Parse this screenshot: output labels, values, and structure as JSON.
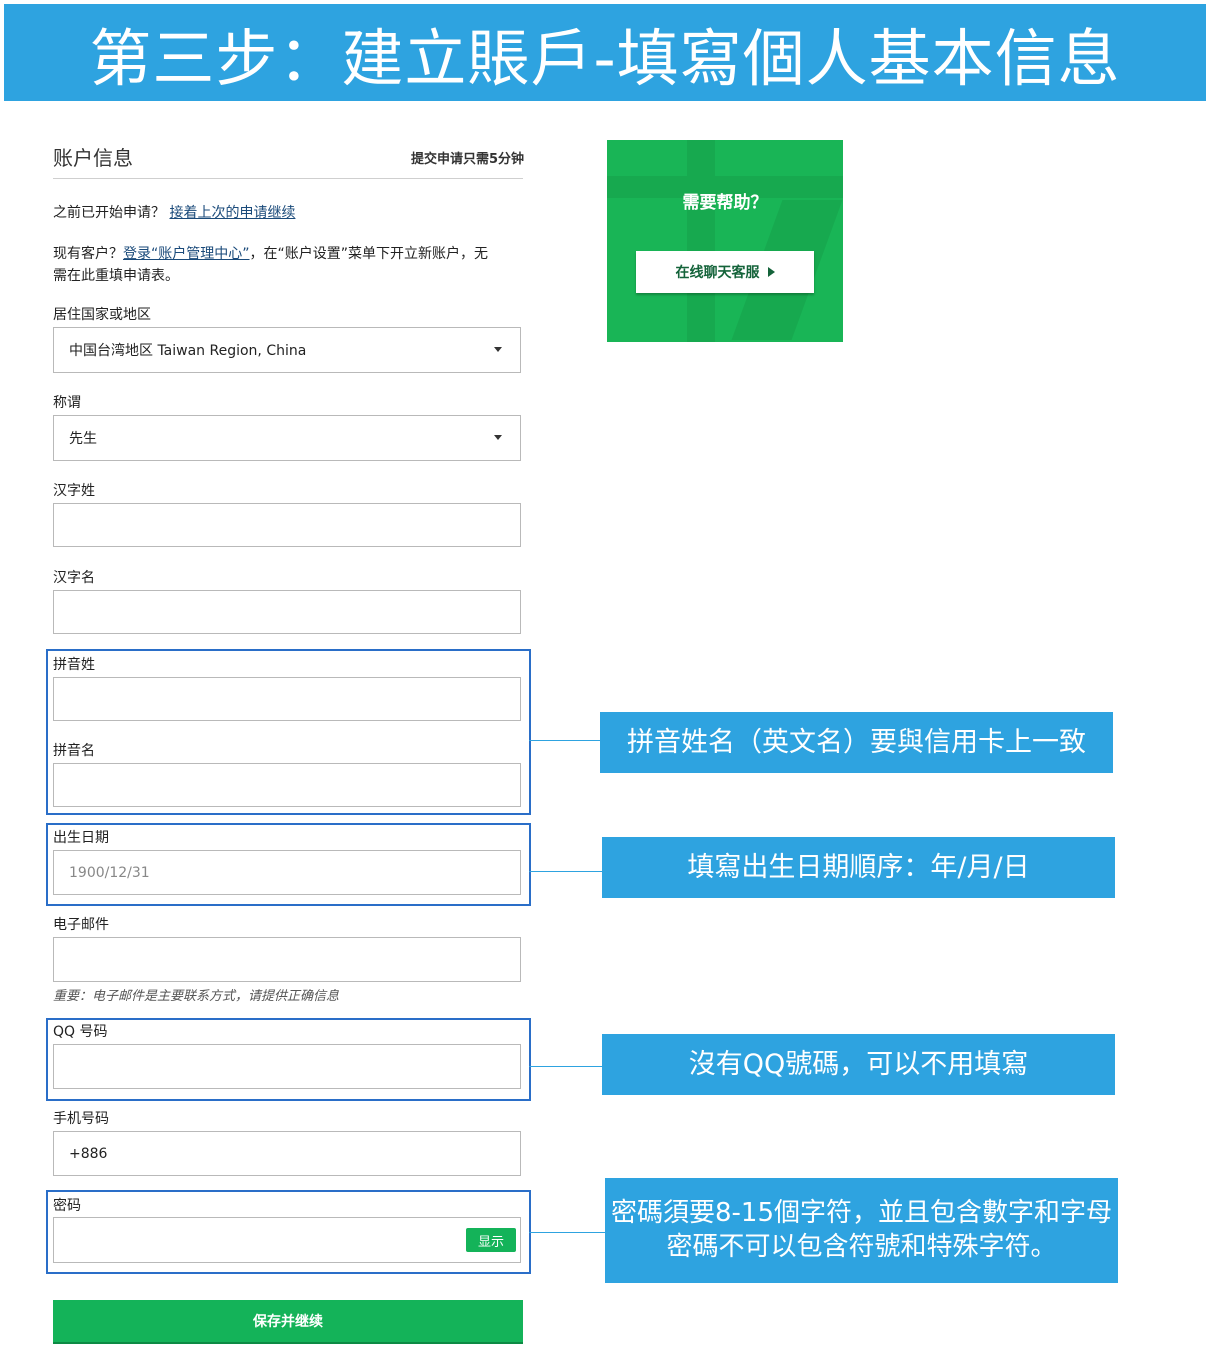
{
  "banner": {
    "title": "第三步：建立賬戶-填寫個人基本信息"
  },
  "section": {
    "title": "账户信息",
    "note": "提交申请只需5分钟"
  },
  "resume": {
    "text": "之前已开始申请？",
    "link": "接着上次的申请继续"
  },
  "existing": {
    "prefix": "现有客户？",
    "link": "登录“账户管理中心”",
    "suffix_line1": "，在“账户设置”菜单下开立新账户，无",
    "line2": "需在此重填申请表。"
  },
  "fields": {
    "country": {
      "label": "居住国家或地区",
      "value": "中国台湾地区 Taiwan Region, China"
    },
    "title": {
      "label": "称谓",
      "value": "先生"
    },
    "surname_cn": {
      "label": "汉字姓",
      "value": ""
    },
    "givenname_cn": {
      "label": "汉字名",
      "value": ""
    },
    "surname_py": {
      "label": "拼音姓",
      "value": ""
    },
    "givenname_py": {
      "label": "拼音名",
      "value": ""
    },
    "dob": {
      "label": "出生日期",
      "placeholder": "1900/12/31"
    },
    "email": {
      "label": "电子邮件",
      "value": "",
      "note": "重要：电子邮件是主要联系方式，请提供正确信息"
    },
    "qq": {
      "label": "QQ 号码",
      "value": ""
    },
    "mobile": {
      "label": "手机号码",
      "value": "+886"
    },
    "password": {
      "label": "密码",
      "value": "",
      "show_label": "显示"
    }
  },
  "save_button": "保存并继续",
  "help": {
    "title": "需要帮助？",
    "button": "在线聊天客服"
  },
  "callouts": {
    "pinyin": "拼音姓名（英文名）要與信用卡上一致",
    "dob": "填寫出生日期順序：年/月/日",
    "qq": "沒有QQ號碼，可以不用填寫",
    "password_line1": "密碼須要8-15個字符，並且包含數字和字母",
    "password_line2": "密碼不可以包含符號和特殊字符。"
  },
  "colors": {
    "accent_blue": "#2ea3e0",
    "brand_green": "#14b359",
    "highlight_border": "#2a6ec8"
  }
}
